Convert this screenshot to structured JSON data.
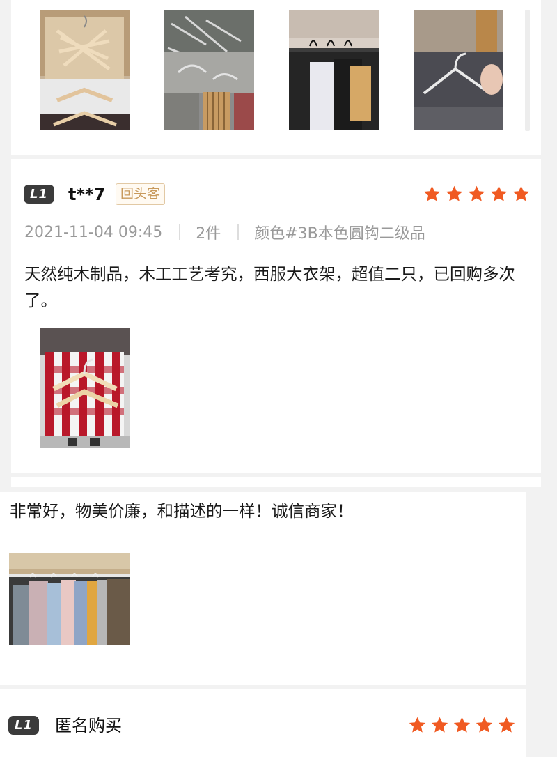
{
  "review_top": {
    "photos": [
      {
        "icon": "hanger-box-photo"
      },
      {
        "icon": "hanger-parts-photo"
      },
      {
        "icon": "closet-coats-photo"
      },
      {
        "icon": "hanger-in-hand-photo"
      }
    ]
  },
  "review_1": {
    "level": "L1",
    "user": "t**7",
    "tag": "回头客",
    "rating": 5,
    "date": "2021-11-04 09:45",
    "quantity": "2件",
    "variant": "颜色#3B本色圆钩二级品",
    "text": "天然纯木制品，木工工艺考究，西服大衣架，超值二只，已回购多次了。",
    "photos": [
      {
        "icon": "hangers-on-checked-cloth-photo"
      }
    ]
  },
  "review_2": {
    "text": "非常好，物美价廉，和描述的一样！诚信商家！",
    "photos": [
      {
        "icon": "wardrobe-shirts-photo"
      }
    ]
  },
  "review_3": {
    "level": "L1",
    "user": "匿名购买",
    "rating": 5
  },
  "colors": {
    "star": "#f05a22",
    "badge": "#3b3b3b",
    "tag_text": "#c89a5c",
    "tag_border": "#e2c9a4"
  }
}
